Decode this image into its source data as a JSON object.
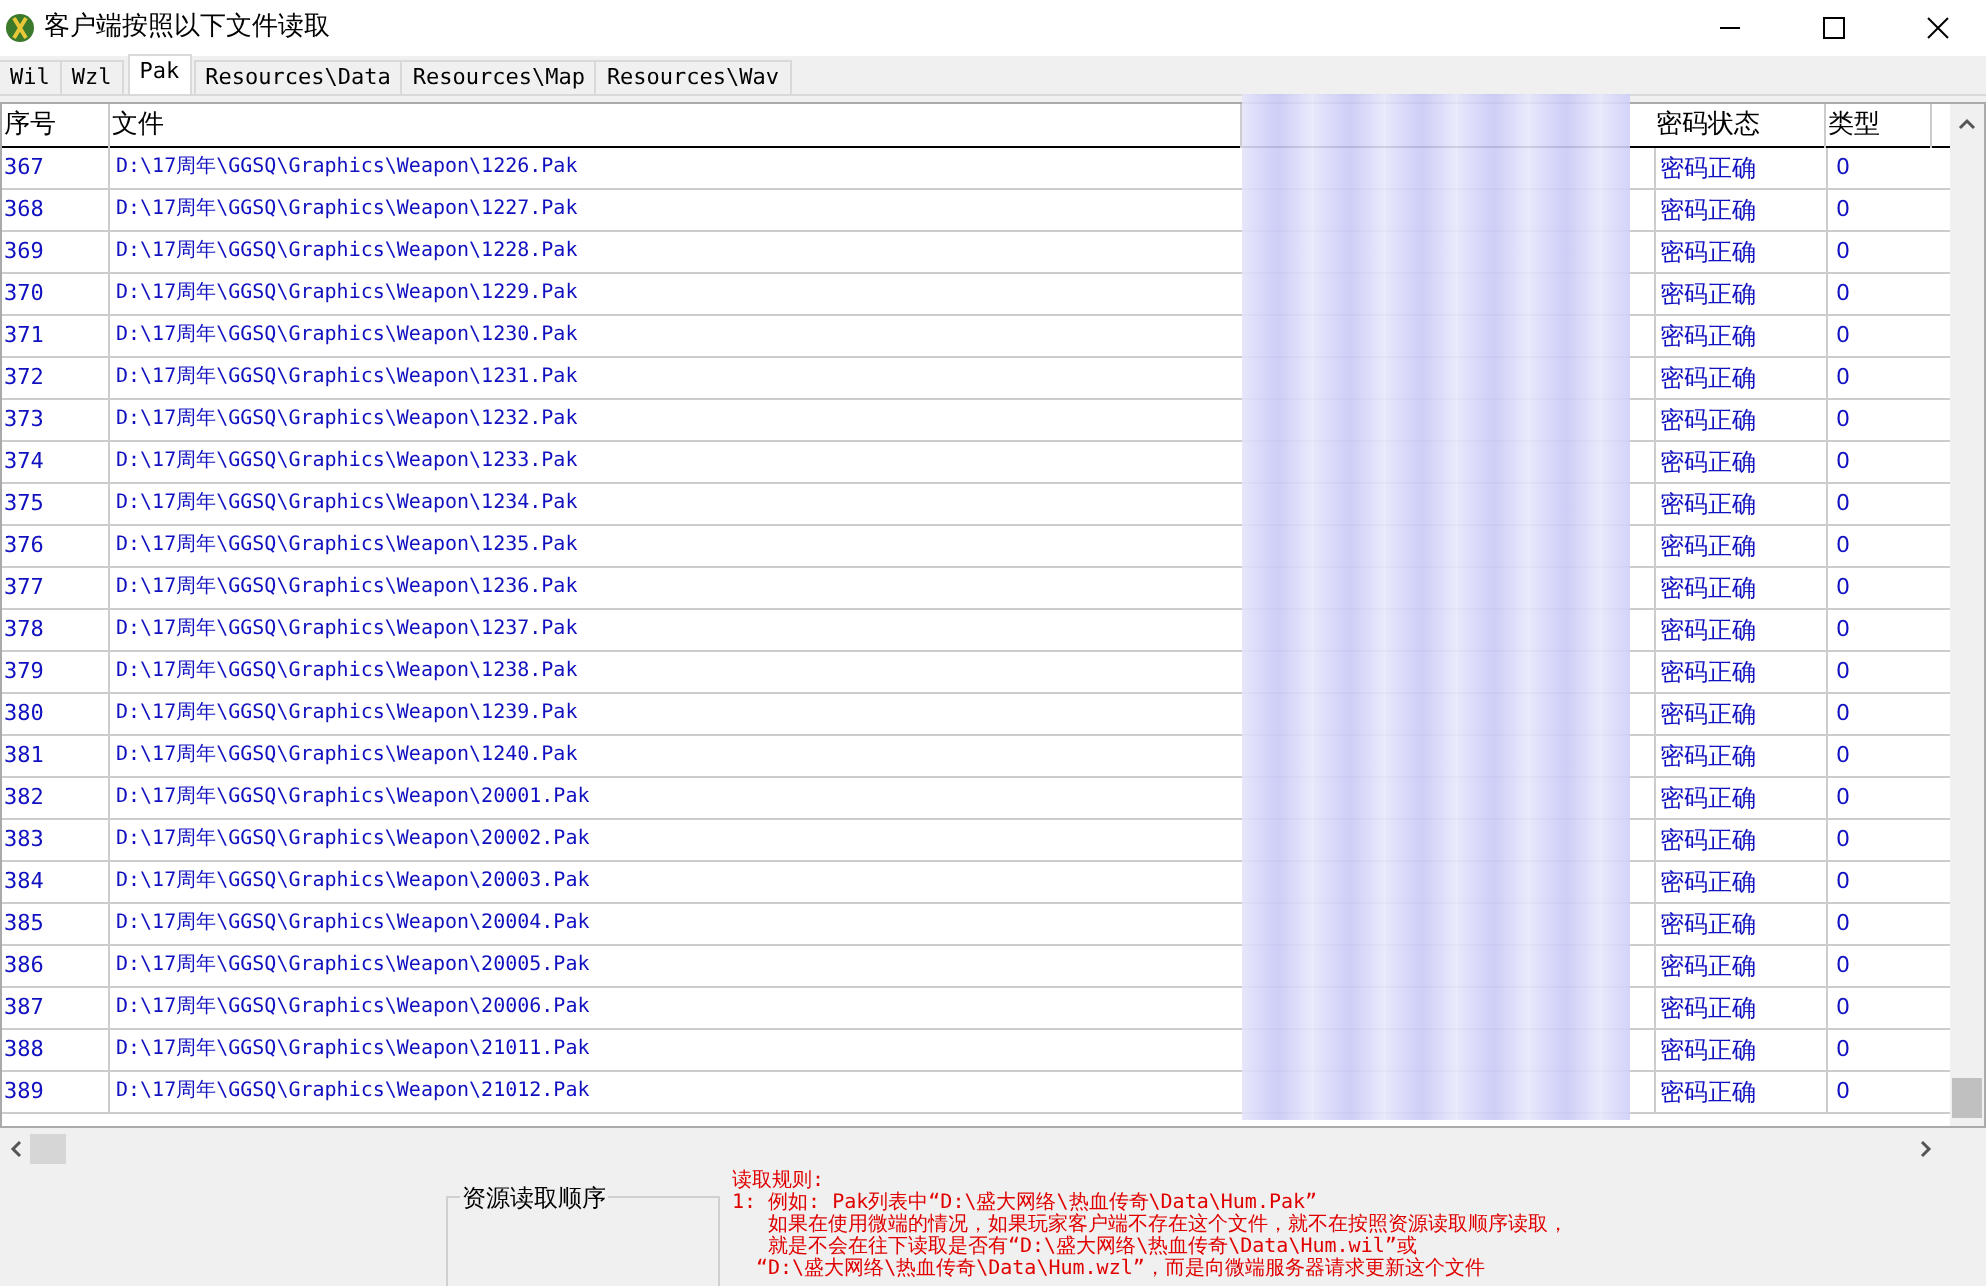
{
  "window": {
    "title": "客户端按照以下文件读取"
  },
  "tabs": [
    {
      "label": "Wil",
      "selected": false
    },
    {
      "label": "Wzl",
      "selected": false
    },
    {
      "label": "Pak",
      "selected": true
    },
    {
      "label": "Resources\\Data",
      "selected": false
    },
    {
      "label": "Resources\\Map",
      "selected": false
    },
    {
      "label": "Resources\\Wav",
      "selected": false
    }
  ],
  "table": {
    "columns": [
      "序号",
      "文件",
      "密码状态",
      "类型"
    ],
    "rows": [
      [
        "367",
        "D:\\17周年\\GGSQ\\Graphics\\Weapon\\1226.Pak",
        "密码正确",
        "0"
      ],
      [
        "368",
        "D:\\17周年\\GGSQ\\Graphics\\Weapon\\1227.Pak",
        "密码正确",
        "0"
      ],
      [
        "369",
        "D:\\17周年\\GGSQ\\Graphics\\Weapon\\1228.Pak",
        "密码正确",
        "0"
      ],
      [
        "370",
        "D:\\17周年\\GGSQ\\Graphics\\Weapon\\1229.Pak",
        "密码正确",
        "0"
      ],
      [
        "371",
        "D:\\17周年\\GGSQ\\Graphics\\Weapon\\1230.Pak",
        "密码正确",
        "0"
      ],
      [
        "372",
        "D:\\17周年\\GGSQ\\Graphics\\Weapon\\1231.Pak",
        "密码正确",
        "0"
      ],
      [
        "373",
        "D:\\17周年\\GGSQ\\Graphics\\Weapon\\1232.Pak",
        "密码正确",
        "0"
      ],
      [
        "374",
        "D:\\17周年\\GGSQ\\Graphics\\Weapon\\1233.Pak",
        "密码正确",
        "0"
      ],
      [
        "375",
        "D:\\17周年\\GGSQ\\Graphics\\Weapon\\1234.Pak",
        "密码正确",
        "0"
      ],
      [
        "376",
        "D:\\17周年\\GGSQ\\Graphics\\Weapon\\1235.Pak",
        "密码正确",
        "0"
      ],
      [
        "377",
        "D:\\17周年\\GGSQ\\Graphics\\Weapon\\1236.Pak",
        "密码正确",
        "0"
      ],
      [
        "378",
        "D:\\17周年\\GGSQ\\Graphics\\Weapon\\1237.Pak",
        "密码正确",
        "0"
      ],
      [
        "379",
        "D:\\17周年\\GGSQ\\Graphics\\Weapon\\1238.Pak",
        "密码正确",
        "0"
      ],
      [
        "380",
        "D:\\17周年\\GGSQ\\Graphics\\Weapon\\1239.Pak",
        "密码正确",
        "0"
      ],
      [
        "381",
        "D:\\17周年\\GGSQ\\Graphics\\Weapon\\1240.Pak",
        "密码正确",
        "0"
      ],
      [
        "382",
        "D:\\17周年\\GGSQ\\Graphics\\Weapon\\20001.Pak",
        "密码正确",
        "0"
      ],
      [
        "383",
        "D:\\17周年\\GGSQ\\Graphics\\Weapon\\20002.Pak",
        "密码正确",
        "0"
      ],
      [
        "384",
        "D:\\17周年\\GGSQ\\Graphics\\Weapon\\20003.Pak",
        "密码正确",
        "0"
      ],
      [
        "385",
        "D:\\17周年\\GGSQ\\Graphics\\Weapon\\20004.Pak",
        "密码正确",
        "0"
      ],
      [
        "386",
        "D:\\17周年\\GGSQ\\Graphics\\Weapon\\20005.Pak",
        "密码正确",
        "0"
      ],
      [
        "387",
        "D:\\17周年\\GGSQ\\Graphics\\Weapon\\20006.Pak",
        "密码正确",
        "0"
      ],
      [
        "388",
        "D:\\17周年\\GGSQ\\Graphics\\Weapon\\21011.Pak",
        "密码正确",
        "0"
      ],
      [
        "389",
        "D:\\17周年\\GGSQ\\Graphics\\Weapon\\21012.Pak",
        "密码正确",
        "0"
      ]
    ]
  },
  "order_panel": {
    "title": "资源读取顺序"
  },
  "rules": {
    "title": "读取规则:",
    "lines": [
      "1: 例如: Pak列表中“D:\\盛大网络\\热血传奇\\Data\\Hum.Pak”",
      "如果在使用微端的情况，如果玩家客户端不存在这个文件，就不在按照资源读取顺序读取，",
      "就是不会在往下读取是否有“D:\\盛大网络\\热血传奇\\Data\\Hum.wil”或",
      "“D:\\盛大网络\\热血传奇\\Data\\Hum.wzl”，而是向微端服务器请求更新这个文件"
    ]
  }
}
